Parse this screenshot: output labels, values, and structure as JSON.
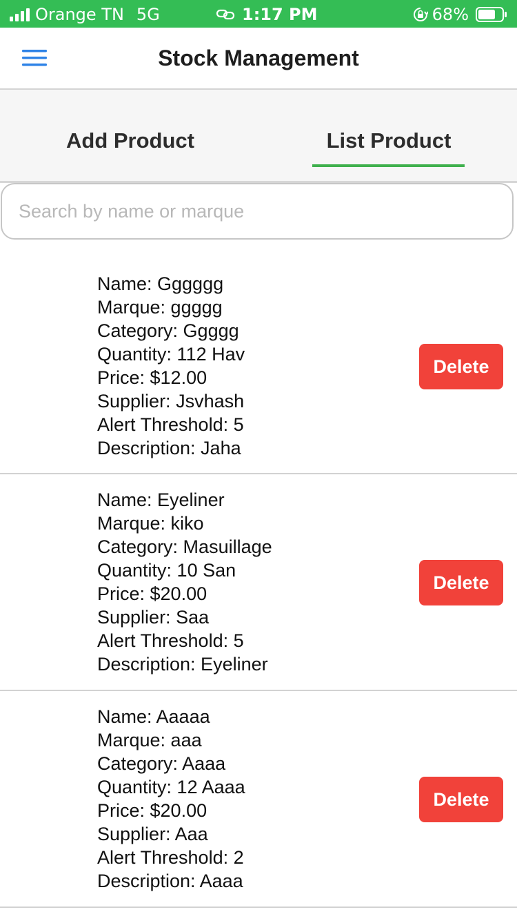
{
  "status_bar": {
    "carrier": "Orange TN",
    "network": "5G",
    "time": "1:17 PM",
    "battery": "68%",
    "icons": [
      "signal-icon",
      "link-icon",
      "orientation-lock-icon",
      "battery-icon"
    ],
    "background_color": "#34bd55"
  },
  "header": {
    "title": "Stock Management",
    "menu_icon": "hamburger-menu-icon",
    "menu_icon_color": "#2d82e6"
  },
  "tabs": {
    "items": [
      {
        "label": "Add Product",
        "active": false
      },
      {
        "label": "List Product",
        "active": true
      }
    ],
    "indicator_color": "#3fb04d"
  },
  "search": {
    "placeholder": "Search by name or marque",
    "value": ""
  },
  "products": [
    {
      "name": "Name: Gggggg",
      "marque": "Marque: ggggg",
      "category": "Category: Ggggg",
      "quantity": "Quantity: 112 Hav",
      "price": "Price: $12.00",
      "supplier": "Supplier: Jsvhash",
      "alert_threshold": "Alert Threshold: 5",
      "description": "Description: Jaha",
      "delete_label": "Delete"
    },
    {
      "name": "Name: Eyeliner",
      "marque": "Marque: kiko",
      "category": "Category: Masuillage",
      "quantity": "Quantity: 10 San",
      "price": "Price: $20.00",
      "supplier": "Supplier: Saa",
      "alert_threshold": "Alert Threshold: 5",
      "description": "Description: Eyeliner",
      "delete_label": "Delete"
    },
    {
      "name": "Name: Aaaaa",
      "marque": "Marque: aaa",
      "category": "Category: Aaaa",
      "quantity": "Quantity: 12 Aaaa",
      "price": "Price: $20.00",
      "supplier": "Supplier: Aaa",
      "alert_threshold": "Alert Threshold: 2",
      "description": "Description: Aaaa",
      "delete_label": "Delete"
    }
  ],
  "colors": {
    "delete_button": "#f1423a"
  }
}
